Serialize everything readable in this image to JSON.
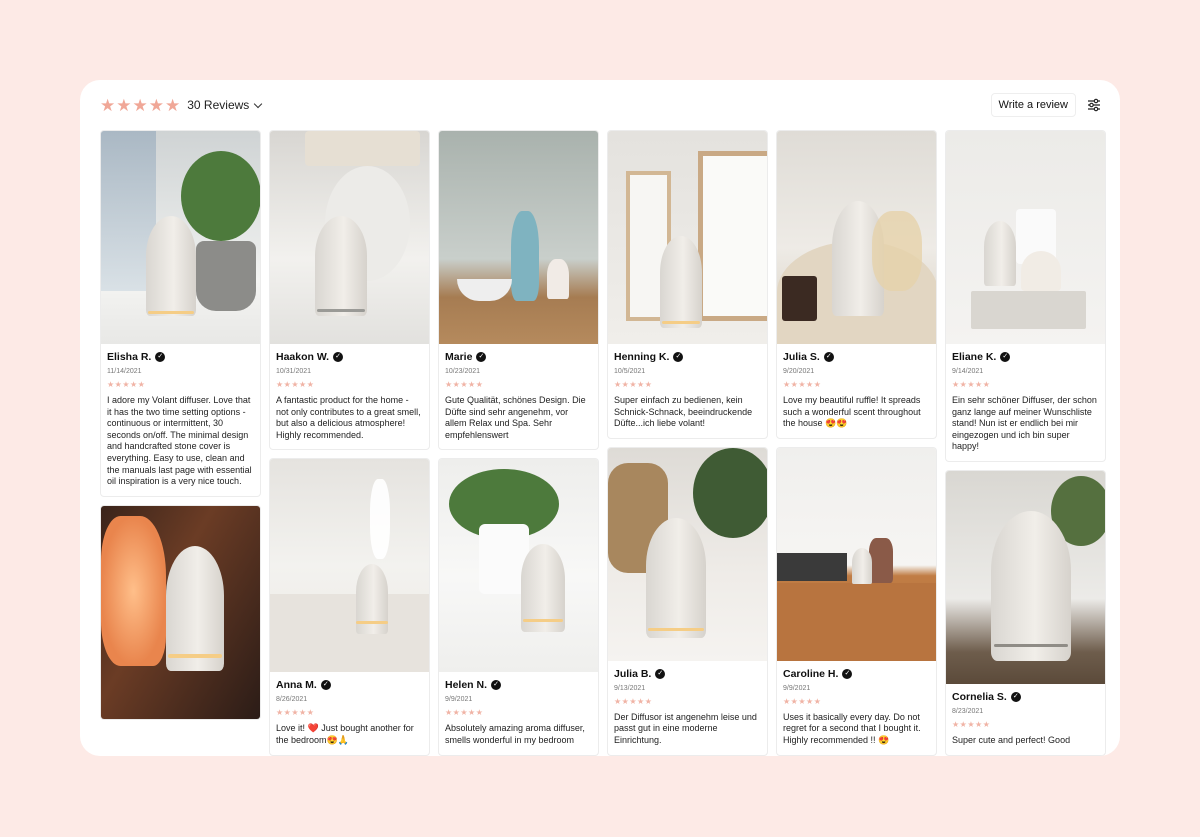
{
  "header": {
    "rating_stars": 5,
    "reviews_label": "30 Reviews",
    "write_review_label": "Write a review"
  },
  "columns": [
    [
      {
        "name": "Elisha R.",
        "date": "11/14/2021",
        "text": "I adore my Volant diffuser. Love that it has the two time setting options - continuous or intermittent, 30 seconds on/off. The minimal design and handcrafted stone cover is everything. Easy to use, clean and the manuals last page with essential oil inspiration is a very nice touch.",
        "photo": "window-plant"
      },
      {
        "name": "",
        "date": "",
        "text": "",
        "photo": "salt-lamp"
      }
    ],
    [
      {
        "name": "Haakon W.",
        "date": "10/31/2021",
        "text": "A fantastic product for the home - not only contributes to a great smell, but also a delicious atmosphere! Highly recommended.",
        "photo": "lamp-window"
      },
      {
        "name": "Anna M.",
        "date": "8/26/2021",
        "text": "Love it! ❤️ Just bought another for the bedroom😍🙏",
        "photo": "mist-table"
      }
    ],
    [
      {
        "name": "Marie",
        "date": "10/23/2021",
        "text": "Gute Qualität, schönes Design. Die Düfte sind sehr angenehm, vor allem Relax und Spa. Sehr empfehlenswert",
        "photo": "shelf-vase"
      },
      {
        "name": "Helen N.",
        "date": "9/9/2021",
        "text": "Absolutely amazing aroma diffuser, smells wonderful in my bedroom",
        "photo": "white-plant"
      }
    ],
    [
      {
        "name": "Henning K.",
        "date": "10/5/2021",
        "text": "Super einfach zu bedienen, kein Schnick-Schnack, beeindruckende Düfte...ich liebe volant!",
        "photo": "frames"
      },
      {
        "name": "Julia B.",
        "date": "9/13/2021",
        "text": "Der Diffusor ist angenehm leise und passt gut in eine moderne Einrichtung.",
        "photo": "basket-plant"
      }
    ],
    [
      {
        "name": "Julia S.",
        "date": "9/20/2021",
        "text": "Love my beautiful ruffle! It spreads such a wonderful scent throughout the house 😍😍",
        "photo": "oil-lamp"
      },
      {
        "name": "Caroline H.",
        "date": "9/9/2021",
        "text": "Uses it basically every day. Do not regret for a second that I bought it. Highly recommended !! 😍",
        "photo": "cabinet"
      }
    ],
    [
      {
        "name": "Eliane K.",
        "date": "9/14/2021",
        "text": "Ein sehr schöner Diffuser, der schon ganz lange auf meiner Wunschliste stand! Nun ist er endlich bei mir eingezogen und ich bin super happy!",
        "photo": "books"
      },
      {
        "name": "Cornelia S.",
        "date": "8/23/2021",
        "text": "Super cute and perfect! Good",
        "photo": "closeup"
      }
    ]
  ]
}
